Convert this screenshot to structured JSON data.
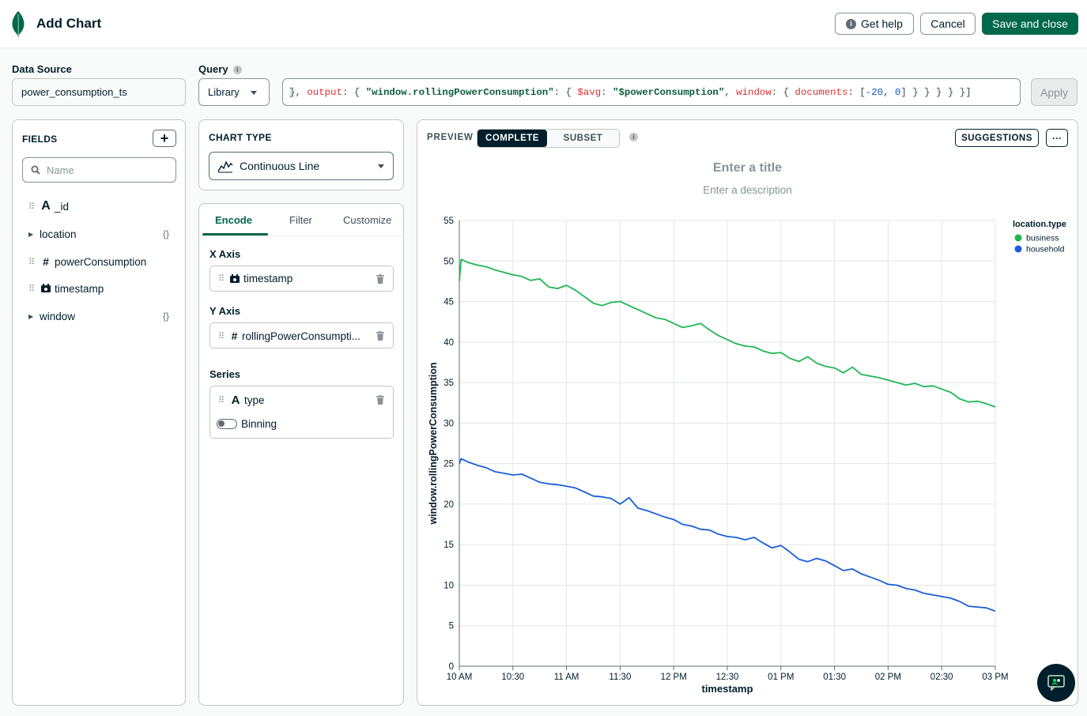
{
  "header": {
    "title": "Add Chart",
    "help_label": "Get help",
    "cancel_label": "Cancel",
    "save_label": "Save and close"
  },
  "data_source": {
    "label": "Data Source",
    "value": "power_consumption_ts"
  },
  "query": {
    "label": "Query",
    "library_label": "Library",
    "apply_label": "Apply"
  },
  "fields": {
    "title": "FIELDS",
    "search_placeholder": "Name",
    "items": [
      {
        "type": "string",
        "name": "_id"
      },
      {
        "type": "object",
        "name": "location"
      },
      {
        "type": "number",
        "name": "powerConsumption"
      },
      {
        "type": "date",
        "name": "timestamp"
      },
      {
        "type": "object",
        "name": "window"
      }
    ]
  },
  "chart_type": {
    "title": "CHART TYPE",
    "value": "Continuous Line"
  },
  "encode": {
    "tabs": [
      "Encode",
      "Filter",
      "Customize"
    ],
    "x_axis": {
      "label": "X Axis",
      "field": "timestamp"
    },
    "y_axis": {
      "label": "Y Axis",
      "field": "rollingPowerConsumpti..."
    },
    "series": {
      "label": "Series",
      "field": "type",
      "binning_label": "Binning"
    }
  },
  "preview": {
    "label": "PREVIEW",
    "complete_label": "COMPLETE",
    "subset_label": "SUBSET",
    "suggestions_label": "SUGGESTIONS",
    "more_label": "···",
    "title_placeholder": "Enter a title",
    "description_placeholder": "Enter a description"
  },
  "chart_data": {
    "type": "line",
    "xlabel": "timestamp",
    "ylabel": "window.rollingPowerConsumption",
    "ylim": [
      0,
      55
    ],
    "yticks": [
      0,
      5,
      10,
      15,
      20,
      25,
      30,
      35,
      40,
      45,
      50,
      55
    ],
    "xlim": [
      0,
      300
    ],
    "xticks": [
      0,
      30,
      60,
      90,
      120,
      150,
      180,
      210,
      240,
      270,
      300
    ],
    "xtick_labels": [
      "10 AM",
      "10:30",
      "11 AM",
      "11:30",
      "12 PM",
      "12:30",
      "01 PM",
      "01:30",
      "02 PM",
      "02:30",
      "03 PM"
    ],
    "legend_title": "location.type",
    "legend_position": "right",
    "grid": true,
    "series": [
      {
        "name": "business",
        "color": "#20b754",
        "x": [
          0,
          1,
          5,
          10,
          15,
          20,
          25,
          30,
          35,
          40,
          45,
          50,
          55,
          60,
          65,
          70,
          75,
          80,
          85,
          90,
          95,
          100,
          105,
          110,
          115,
          120,
          125,
          130,
          135,
          140,
          145,
          150,
          155,
          160,
          165,
          170,
          175,
          180,
          185,
          190,
          195,
          200,
          205,
          210,
          215,
          220,
          225,
          230,
          235,
          240,
          245,
          250,
          255,
          260,
          265,
          270,
          275,
          280,
          285,
          290,
          295,
          300
        ],
        "y": [
          47.5,
          50.2,
          49.8,
          49.5,
          49.3,
          48.9,
          48.6,
          48.3,
          48.1,
          47.6,
          47.8,
          46.8,
          46.6,
          47.0,
          46.4,
          45.6,
          44.8,
          44.5,
          44.9,
          45.0,
          44.5,
          44.0,
          43.5,
          43.0,
          42.8,
          42.3,
          41.8,
          42.0,
          42.3,
          41.5,
          40.8,
          40.3,
          39.8,
          39.5,
          39.4,
          38.9,
          38.6,
          38.7,
          38.0,
          37.6,
          38.2,
          37.4,
          37.0,
          36.8,
          36.2,
          36.9,
          36.0,
          35.8,
          35.6,
          35.3,
          35.0,
          34.7,
          34.9,
          34.5,
          34.6,
          34.2,
          33.8,
          33.0,
          32.6,
          32.7,
          32.4,
          32.0
        ]
      },
      {
        "name": "household",
        "color": "#1a5fd9",
        "x": [
          0,
          1,
          5,
          10,
          15,
          20,
          25,
          30,
          35,
          40,
          45,
          50,
          55,
          60,
          65,
          70,
          75,
          80,
          85,
          90,
          95,
          100,
          105,
          110,
          115,
          120,
          125,
          130,
          135,
          140,
          145,
          150,
          155,
          160,
          165,
          170,
          175,
          180,
          185,
          190,
          195,
          200,
          205,
          210,
          215,
          220,
          225,
          230,
          235,
          240,
          245,
          250,
          255,
          260,
          265,
          270,
          275,
          280,
          285,
          290,
          295,
          300
        ],
        "y": [
          25.0,
          25.6,
          25.2,
          24.8,
          24.5,
          24.0,
          23.8,
          23.6,
          23.7,
          23.2,
          22.7,
          22.5,
          22.4,
          22.2,
          22.0,
          21.5,
          21.0,
          20.9,
          20.7,
          20.0,
          20.8,
          19.5,
          19.2,
          18.8,
          18.4,
          18.1,
          17.5,
          17.3,
          16.9,
          16.8,
          16.3,
          16.0,
          15.9,
          15.6,
          15.9,
          15.2,
          14.6,
          14.9,
          14.1,
          13.2,
          12.9,
          13.3,
          13.0,
          12.4,
          11.8,
          12.0,
          11.4,
          11.0,
          10.6,
          10.1,
          10.0,
          9.6,
          9.4,
          9.0,
          8.8,
          8.6,
          8.4,
          8.0,
          7.4,
          7.3,
          7.2,
          6.8
        ]
      }
    ]
  }
}
